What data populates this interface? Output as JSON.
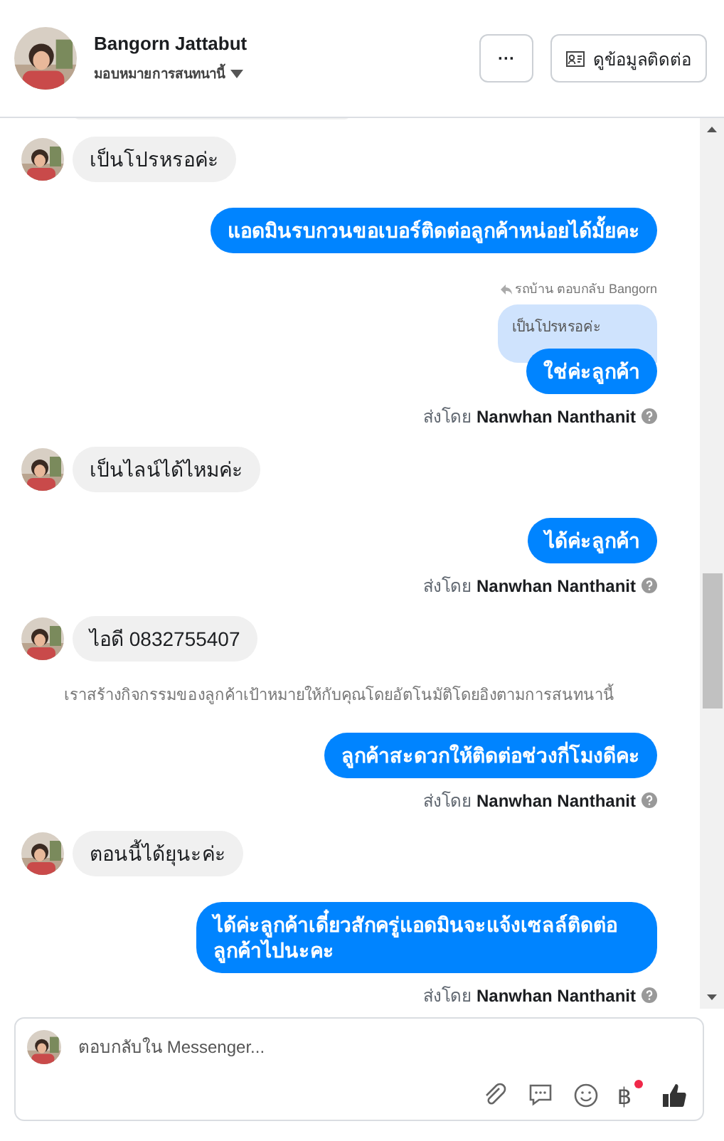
{
  "header": {
    "name": "Bangorn Jattabut",
    "assign_label": "มอบหมายการสนทนานี้",
    "more_button": "···",
    "contact_button": "ดูข้อมูลติดต่อ"
  },
  "messages": [
    {
      "kind": "clipped"
    },
    {
      "kind": "incoming",
      "text": "เป็นโปรหรอค่ะ"
    },
    {
      "kind": "outgoing",
      "text": "แอดมินรบกวนขอเบอร์ติดต่อลูกค้าหน่อยได้มั้ยคะ"
    },
    {
      "kind": "outgoing",
      "reply_label": "รถบ้าน ตอบกลับ Bangorn",
      "quoted": "เป็นโปรหรอค่ะ",
      "text": "ใช่ค่ะลูกค้า",
      "sent_by": "ส่งโดย **Nanwhan Nanthanit**"
    },
    {
      "kind": "incoming",
      "text": "เป็นไลน์ได้ไหมค่ะ"
    },
    {
      "kind": "outgoing",
      "text": "ได้ค่ะลูกค้า",
      "sent_by": "ส่งโดย **Nanwhan Nanthanit**"
    },
    {
      "kind": "incoming",
      "text": "ไอดี 0832755407"
    },
    {
      "kind": "notice",
      "text": "เราสร้างกิจกรรมของลูกค้าเป้าหมายให้กับคุณโดยอัตโนมัติโดยอิงตามการสนทนานี้"
    },
    {
      "kind": "outgoing",
      "text": "ลูกค้าสะดวกให้ติดต่อช่วงกี่โมงดีคะ",
      "sent_by": "ส่งโดย **Nanwhan Nanthanit**"
    },
    {
      "kind": "incoming",
      "text": "ตอนนี้ได้ยุนะค่ะ"
    },
    {
      "kind": "outgoing",
      "text": "ได้ค่ะลูกค้าเดี๋ยวสักครู่แอดมินจะแจ้งเซลล์ติดต่อลูกค้าไปนะคะ",
      "sent_by": "ส่งโดย **Nanwhan Nanthanit**"
    }
  ],
  "composer": {
    "placeholder": "ตอบกลับใน Messenger...",
    "currency_symbol": "฿",
    "currency_badge": true
  }
}
